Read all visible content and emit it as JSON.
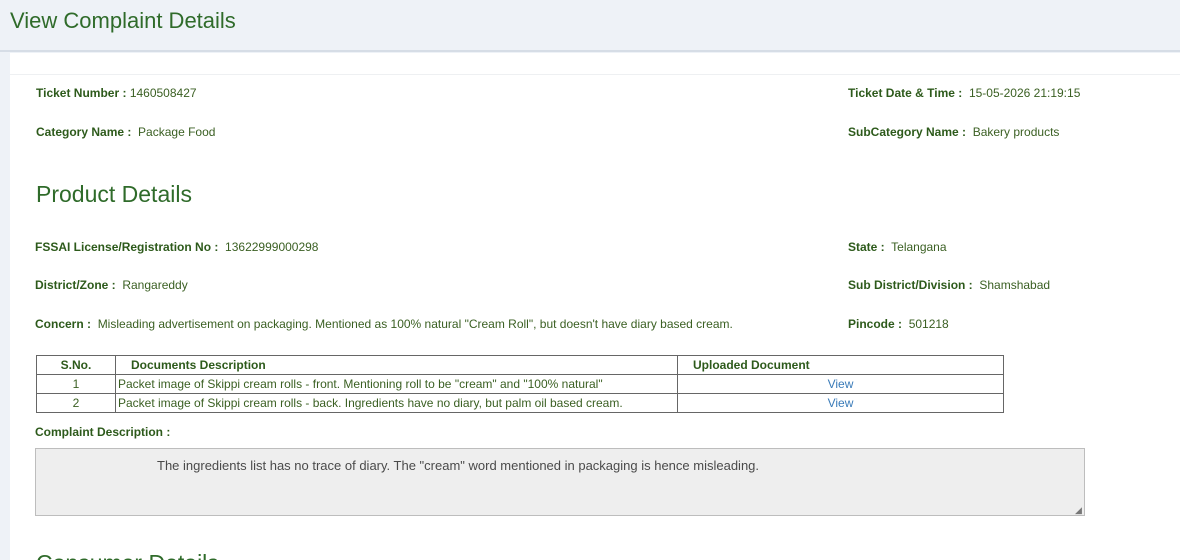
{
  "page": {
    "title": "View Complaint Details"
  },
  "ticket": {
    "number_label": "Ticket Number :",
    "number_value": "1460508427",
    "datetime_label": "Ticket Date & Time :",
    "datetime_value": "15-05-2026 21:19:15",
    "category_label": "Category Name :",
    "category_value": "Package Food",
    "subcategory_label": "SubCategory Name :",
    "subcategory_value": "Bakery products"
  },
  "product": {
    "section_title": "Product Details",
    "license_label": "FSSAI License/Registration No :",
    "license_value": "13622999000298",
    "state_label": "State :",
    "state_value": "Telangana",
    "district_label": "District/Zone :",
    "district_value": "Rangareddy",
    "subdistrict_label": "Sub District/Division :",
    "subdistrict_value": "Shamshabad",
    "concern_label": "Concern :",
    "concern_value": "Misleading advertisement on packaging. Mentioned as 100% natural \"Cream Roll\", but doesn't have diary based cream.",
    "pincode_label": "Pincode :",
    "pincode_value": "501218"
  },
  "documents": {
    "headers": [
      "S.No.",
      "Documents Description",
      "Uploaded Document"
    ],
    "rows": [
      {
        "sno": "1",
        "description": "Packet image of Skippi cream rolls - front. Mentioning roll to be \"cream\" and \"100% natural\"",
        "link": "View"
      },
      {
        "sno": "2",
        "description": "Packet image of Skippi cream rolls - back. Ingredients have no diary, but palm oil based cream.",
        "link": "View"
      }
    ]
  },
  "complaint": {
    "label": "Complaint Description :",
    "text": "The ingredients list has no trace of diary. The \"cream\" word mentioned in packaging is hence misleading."
  },
  "next_section": {
    "title": "Consumer Details"
  }
}
